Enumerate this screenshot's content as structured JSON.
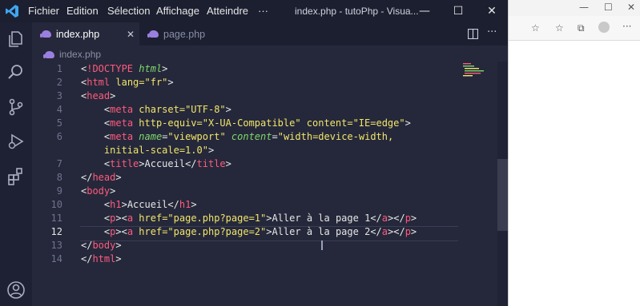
{
  "titlebar": {
    "menu": [
      "Fichier",
      "Edition",
      "Sélection",
      "Affichage",
      "Atteindre",
      "···"
    ],
    "window_title": "index.php - tutoPhp - Visua...",
    "minimize": "—",
    "maximize": "☐",
    "close": "✕"
  },
  "tabs": [
    {
      "label": "index.php",
      "active": true,
      "close": "✕"
    },
    {
      "label": "page.php",
      "active": false
    }
  ],
  "breadcrumb": "index.php",
  "editor": {
    "current_line": 12,
    "lines": [
      {
        "n": "1",
        "text": "<!DOCTYPE html>"
      },
      {
        "n": "2",
        "text": "<html lang=\"fr\">"
      },
      {
        "n": "3",
        "text": "<head>"
      },
      {
        "n": "4",
        "text": "    <meta charset=\"UTF-8\">"
      },
      {
        "n": "5",
        "text": "    <meta http-equiv=\"X-UA-Compatible\" content=\"IE=edge\">"
      },
      {
        "n": "6",
        "text": "    <meta name=\"viewport\" content=\"width=device-width,"
      },
      {
        "n": "",
        "text": "    initial-scale=1.0\">"
      },
      {
        "n": "7",
        "text": "    <title>Accueil</title>"
      },
      {
        "n": "8",
        "text": "</head>"
      },
      {
        "n": "9",
        "text": "<body>"
      },
      {
        "n": "10",
        "text": "    <h1>Accueil</h1>"
      },
      {
        "n": "11",
        "text": "    <p><a href=\"page.php?page=1\">Aller à la page 1</a></p>"
      },
      {
        "n": "12",
        "text": "    <p><a href=\"page.php?page=2\">Aller à la page 2</a></p>"
      },
      {
        "n": "13",
        "text": "</body>"
      },
      {
        "n": "14",
        "text": "</html>"
      }
    ]
  },
  "icons": {
    "logo": "vscode-logo-icon",
    "explorer": "files-icon",
    "search": "search-icon",
    "source_control": "source-control-icon",
    "debug": "run-debug-icon",
    "extensions": "extensions-icon",
    "account": "account-icon"
  },
  "colors": {
    "tag": "#ff5a7e",
    "attr": "#7fd86b",
    "string": "#f2e56b",
    "background": "#25283a",
    "tab_icon": "#9b7fe0"
  }
}
